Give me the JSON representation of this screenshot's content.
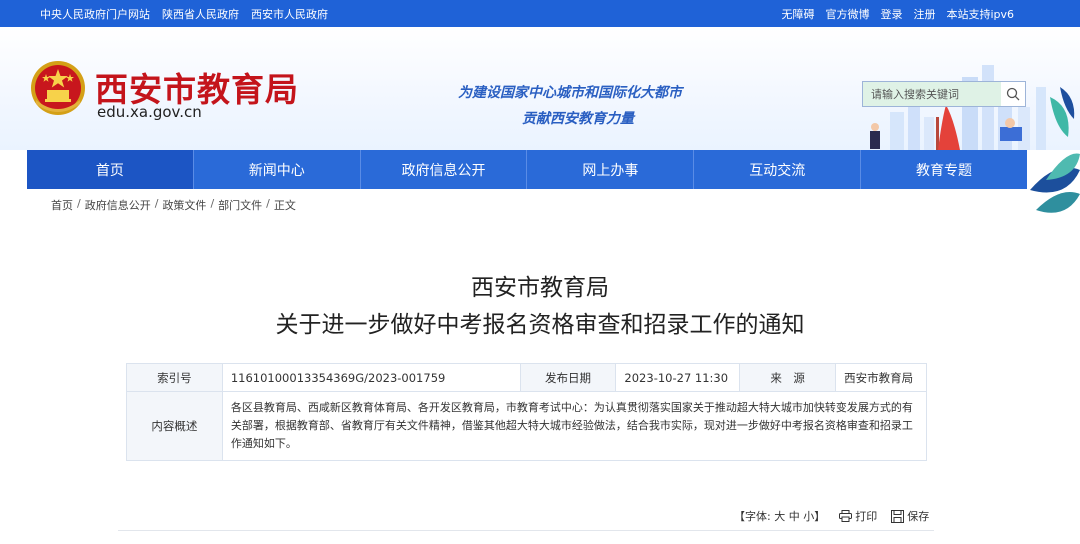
{
  "topbar": {
    "left_links": [
      "中央人民政府门户网站",
      "陕西省人民政府",
      "西安市人民政府"
    ],
    "right_links": [
      "无障碍",
      "官方微博",
      "登录",
      "注册",
      "本站支持ipv6"
    ]
  },
  "header": {
    "site_name": "西安市教育局",
    "domain": "edu.xa.gov.cn",
    "slogan_line1": "为建设国家中心城市和国际化大都市",
    "slogan_line2": "贡献西安教育力量",
    "search_placeholder": "请输入搜索关键词"
  },
  "nav": {
    "items": [
      "首页",
      "新闻中心",
      "政府信息公开",
      "网上办事",
      "互动交流",
      "教育专题"
    ]
  },
  "breadcrumb": {
    "items": [
      "首页",
      "政府信息公开",
      "政策文件",
      "部门文件",
      "正文"
    ]
  },
  "article": {
    "title_line1": "西安市教育局",
    "title_line2": "关于进一步做好中考报名资格审查和招录工作的通知"
  },
  "meta": {
    "index_label": "索引号",
    "index_value": "11610100013354369G/2023-001759",
    "date_label": "发布日期",
    "date_value": "2023-10-27 11:30",
    "source_label": "来　源",
    "source_value": "西安市教育局",
    "summary_label": "内容概述",
    "summary_value": "各区县教育局、西咸新区教育体育局、各开发区教育局，市教育考试中心：为认真贯彻落实国家关于推动超大特大城市加快转变发展方式的有关部署，根据教育部、省教育厅有关文件精神，借鉴其他超大特大城市经验做法，结合我市实际，现对进一步做好中考报名资格审查和招录工作通知如下。"
  },
  "tools": {
    "font_prefix": "【字体:",
    "font_large": "大",
    "font_medium": "中",
    "font_small": "小",
    "font_suffix": "】",
    "print_label": "打印",
    "save_label": "保存"
  },
  "colors": {
    "topbar": "#1f62d7",
    "nav": "#2a6ad8",
    "brand_red": "#c4141b",
    "slogan_blue": "#2a5fc2"
  }
}
